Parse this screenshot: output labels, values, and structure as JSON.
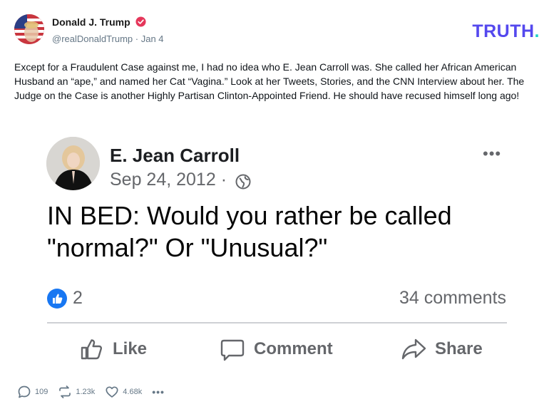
{
  "post": {
    "author_name": "Donald J. Trump",
    "handle": "@realDonaldTrump",
    "date": "Jan 4",
    "brand": "TRUTH",
    "brand_dot": ".",
    "text": "Except for a Fraudulent Case against me, I had no idea who E. Jean Carroll was. She called her African American Husband an “ape,” and named her Cat “Vagina.” Look at her Tweets, Stories, and the CNN Interview about her. The Judge on the Case is another Highly Partisan Clinton-Appointed Friend. He should have recused himself long ago!",
    "stats": {
      "replies": "109",
      "retruths": "1.23k",
      "likes": "4.68k"
    },
    "colors": {
      "brand": "#5448ee",
      "brand_dot": "#1fd1c7",
      "verified": "#e5365a"
    }
  },
  "embed": {
    "name": "E. Jean Carroll",
    "date": "Sep 24, 2012",
    "date_sep": "·",
    "text": "IN BED: Would you rather be called \"normal?\" Or \"Unusual?\"",
    "like_count": "2",
    "comments": "34 comments",
    "actions": {
      "like": "Like",
      "comment": "Comment",
      "share": "Share"
    },
    "colors": {
      "like_badge": "#1877f2"
    }
  }
}
